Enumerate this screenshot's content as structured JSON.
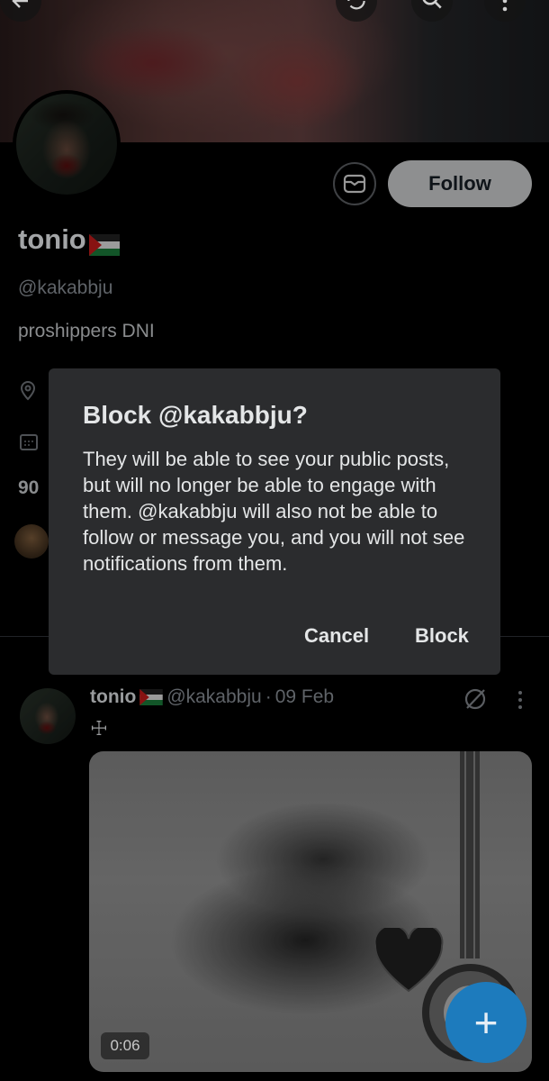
{
  "profile": {
    "name": "tonio",
    "handle": "@kakabbju",
    "bio": "proshippers DNI",
    "count_partial": "90",
    "follow_label": "Follow"
  },
  "tweet": {
    "name": "tonio",
    "handle": "@kakabbju",
    "separator": "·",
    "date": "09 Feb",
    "text": "☩",
    "video_duration": "0:06"
  },
  "dialog": {
    "title": "Block @kakabbju?",
    "body": "They will be able to see your public posts, but will no longer be able to engage with them. @kakabbju will also not be able to follow or message you, and you will not see notifications from them.",
    "cancel_label": "Cancel",
    "block_label": "Block"
  },
  "fab": {
    "label": "+"
  },
  "colors": {
    "background": "#000000",
    "dialog": "#2b2c2e",
    "follow_button": "#8e8f90",
    "fab": "#1d7bbd"
  },
  "icons": {
    "back": "arrow-left-icon",
    "repost": "repost-icon",
    "search": "search-icon",
    "more": "more-vertical-icon",
    "message": "mail-icon",
    "location": "location-pin-icon",
    "calendar": "calendar-icon",
    "grok": "grok-icon",
    "compose": "plus-icon"
  }
}
